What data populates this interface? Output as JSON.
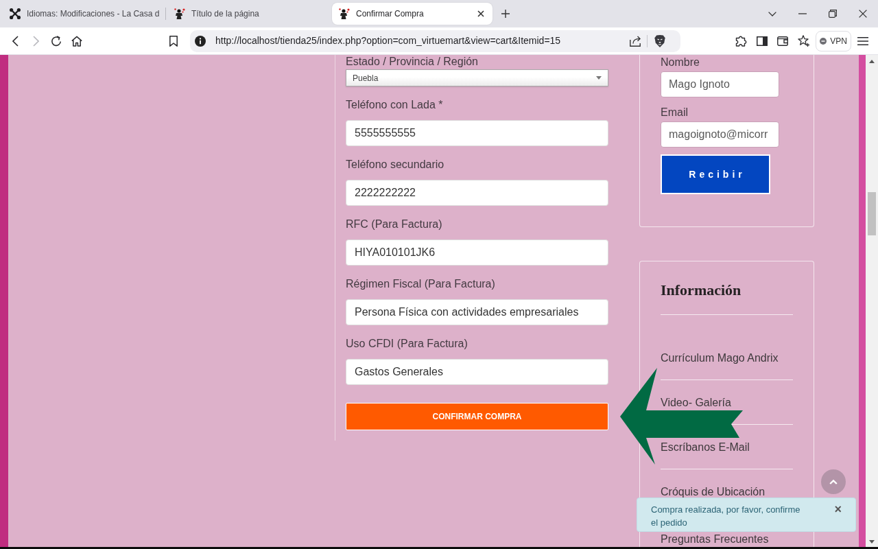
{
  "browser": {
    "tabs": [
      {
        "title": "Idiomas: Modificaciones - La Casa d",
        "kind": "cms",
        "selected": false
      },
      {
        "title": "Título de la página",
        "kind": "site",
        "selected": false
      },
      {
        "title": "Confirmar Compra",
        "kind": "site",
        "selected": true
      }
    ],
    "nav_buttons": [
      {
        "kind": "back",
        "disabled": false
      },
      {
        "kind": "forward",
        "disabled": true
      }
    ],
    "url": "http://localhost/tienda25/index.php?option=com_virtuemart&view=cart&Itemid=15",
    "vpn": {
      "label": "VPN",
      "on": false
    }
  },
  "checkout_form": {
    "fields": [
      {
        "label": "Estado / Provincia / Región",
        "kind": "select",
        "value": "Puebla"
      },
      {
        "label": "Teléfono con Lada *",
        "kind": "text",
        "value": "5555555555"
      },
      {
        "label": "Teléfono secundario",
        "kind": "text",
        "value": "2222222222"
      },
      {
        "label": "RFC (Para Factura)",
        "kind": "text",
        "value": "HIYA010101JK6"
      },
      {
        "label": "Régimen Fiscal (Para Factura)",
        "kind": "text",
        "value": "Persona Física con actividades empresariales"
      },
      {
        "label": "Uso CFDI (Para Factura)",
        "kind": "text",
        "value": "Gastos Generales"
      }
    ],
    "submit": "CONFIRMAR COMPRA"
  },
  "newsletter": {
    "fields": [
      {
        "label": "Nombre",
        "value": "Mago Ignoto"
      },
      {
        "label": "Email",
        "value": "magoignoto@micorr"
      }
    ],
    "button": "Recibir"
  },
  "info_menu": {
    "title": "Información",
    "links": [
      "Currículum Mago Andrix",
      "Video- Galería",
      "Escríbanos E-Mail",
      "Cróquis de Ubicación",
      "Preguntas Frecuentes"
    ]
  },
  "alert": {
    "message": "Compra realizada, por favor, confirme el pedido",
    "close": "×"
  }
}
